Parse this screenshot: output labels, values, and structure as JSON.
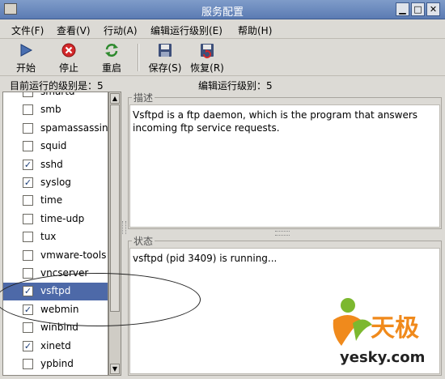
{
  "window": {
    "title": "服务配置",
    "controls": {
      "minimize": "▁",
      "maximize": "□",
      "close": "✕"
    }
  },
  "menu": [
    "文件(F)",
    "查看(V)",
    "行动(A)",
    "编辑运行级别(E)",
    "帮助(H)"
  ],
  "toolbar": {
    "start": "开始",
    "stop": "停止",
    "restart": "重启",
    "save": "保存(S)",
    "revert": "恢复(R)"
  },
  "status": {
    "current_runlevel": "目前运行的级别是：5",
    "edit_runlevel": "编辑运行级别：5"
  },
  "services": [
    {
      "name": "smartd",
      "checked": false
    },
    {
      "name": "smb",
      "checked": false
    },
    {
      "name": "spamassassin",
      "checked": false
    },
    {
      "name": "squid",
      "checked": false
    },
    {
      "name": "sshd",
      "checked": true
    },
    {
      "name": "syslog",
      "checked": true
    },
    {
      "name": "time",
      "checked": false
    },
    {
      "name": "time-udp",
      "checked": false
    },
    {
      "name": "tux",
      "checked": false
    },
    {
      "name": "vmware-tools",
      "checked": false
    },
    {
      "name": "vncserver",
      "checked": false
    },
    {
      "name": "vsftpd",
      "checked": true,
      "selected": true
    },
    {
      "name": "webmin",
      "checked": true
    },
    {
      "name": "winbind",
      "checked": false
    },
    {
      "name": "xinetd",
      "checked": true
    },
    {
      "name": "ypbind",
      "checked": false
    }
  ],
  "description": {
    "label": "描述",
    "text": "Vsftpd is a ftp daemon, which is the program that answers incoming ftp service requests."
  },
  "state": {
    "label": "状态",
    "text": "vsftpd (pid 3409) is running..."
  },
  "watermark": {
    "brand_cn": "天极",
    "brand_url": "yesky.com"
  },
  "colors": {
    "selection": "#4d69a8",
    "titlebar": "#6b89be",
    "logo_orange": "#f08a1c",
    "logo_green": "#7cb82f"
  }
}
